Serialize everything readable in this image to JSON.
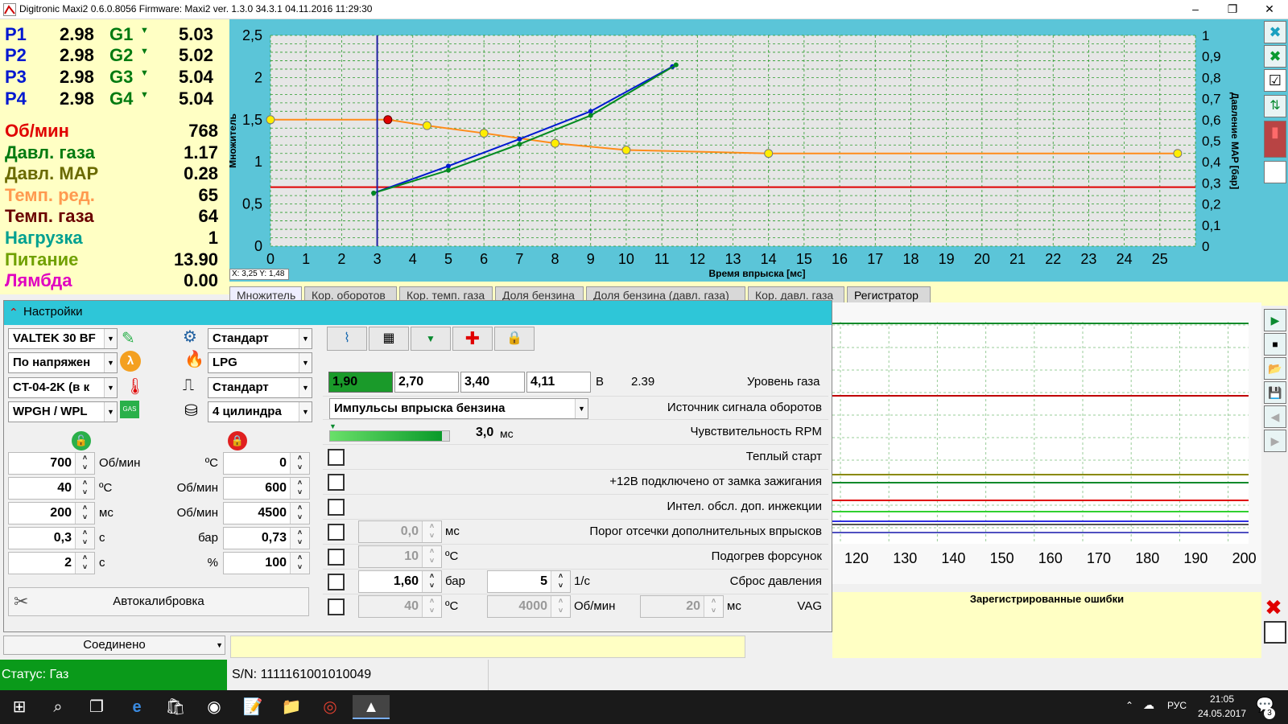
{
  "window": {
    "title": "Digitronic Maxi2 0.6.0.8056 Firmware: Maxi2  ver. 1.3.0  34.3.1   04.11.2016 11:29:30",
    "minimize": "–",
    "maximize": "❐",
    "close": "✕"
  },
  "readouts": {
    "p": [
      {
        "label": "P1",
        "value": "2.98"
      },
      {
        "label": "P2",
        "value": "2.98"
      },
      {
        "label": "P3",
        "value": "2.98"
      },
      {
        "label": "P4",
        "value": "2.98"
      }
    ],
    "g": [
      {
        "label": "G1",
        "value": "5.03"
      },
      {
        "label": "G2",
        "value": "5.02"
      },
      {
        "label": "G3",
        "value": "5.04"
      },
      {
        "label": "G4",
        "value": "5.04"
      }
    ],
    "params": [
      {
        "label": "Об/мин",
        "value": "768",
        "color": "#e00000"
      },
      {
        "label": "Давл. газа",
        "value": "1.17",
        "color": "#007a10"
      },
      {
        "label": "Давл. MAP",
        "value": "0.28",
        "color": "#6a6a00"
      },
      {
        "label": "Темп. ред.",
        "value": "65",
        "color": "#ff9a50"
      },
      {
        "label": "Темп. газа",
        "value": "64",
        "color": "#6a0000"
      },
      {
        "label": "Нагрузка",
        "value": "1",
        "color": "#00a090"
      },
      {
        "label": "Питание",
        "value": "13.90",
        "color": "#70a000"
      },
      {
        "label": "Лямбда",
        "value": "0.00",
        "color": "#e000c0"
      }
    ]
  },
  "chart_data": {
    "type": "line",
    "xlabel": "Время впрыска [мс]",
    "ylabel": "Множитель",
    "y2label": "Давление MAP [бар]",
    "xlim": [
      0,
      26
    ],
    "ylim": [
      0,
      2.5
    ],
    "y2lim": [
      0,
      1
    ],
    "xticks": [
      "0",
      "1",
      "2",
      "3",
      "4",
      "5",
      "6",
      "7",
      "8",
      "9",
      "10",
      "11",
      "12",
      "13",
      "14",
      "15",
      "16",
      "17",
      "18",
      "19",
      "20",
      "21",
      "22",
      "23",
      "24",
      "25"
    ],
    "yticks": [
      "0",
      "0,5",
      "1",
      "1,5",
      "2",
      "2,5"
    ],
    "y2ticks": [
      "0",
      "0,1",
      "0,2",
      "0,3",
      "0,4",
      "0,5",
      "0,6",
      "0,7",
      "0,8",
      "0,9",
      "1"
    ],
    "cursor_readout": "X: 3,25  Y: 1,48",
    "cursor_x": 3.0,
    "red_line_y": 0.7,
    "series": [
      {
        "points": [
          [
            0,
            1.5
          ],
          [
            3.3,
            1.5
          ],
          [
            4.4,
            1.43
          ],
          [
            6,
            1.34
          ],
          [
            8,
            1.22
          ],
          [
            10,
            1.14
          ],
          [
            14,
            1.1
          ],
          [
            25.5,
            1.1
          ]
        ],
        "color": "#ff8c1a"
      },
      {
        "points": [
          [
            2.9,
            0.63
          ],
          [
            5,
            0.95
          ],
          [
            7,
            1.27
          ],
          [
            9,
            1.6
          ],
          [
            11.3,
            2.13
          ]
        ],
        "color": "#0018d0"
      },
      {
        "points": [
          [
            2.9,
            0.63
          ],
          [
            5,
            0.9
          ],
          [
            7,
            1.21
          ],
          [
            9,
            1.55
          ],
          [
            11.4,
            2.15
          ]
        ],
        "color": "#008a20"
      }
    ],
    "yellow_points": [
      [
        0,
        1.5
      ],
      [
        4.4,
        1.43
      ],
      [
        6,
        1.34
      ],
      [
        8,
        1.22
      ],
      [
        10,
        1.14
      ],
      [
        14,
        1.1
      ],
      [
        25.5,
        1.1
      ]
    ],
    "red_point": [
      3.3,
      1.5
    ]
  },
  "tabs": [
    "Множитель",
    "Кор. оборотов",
    "Кор. темп. газа",
    "Доля бензина",
    "Доля бензина (давл. газа)",
    "Кор. давл. газа",
    "Регистратор"
  ],
  "settings": {
    "header": "Настройки",
    "left_selects": [
      "VALTEK 30 BF",
      "По напряжен",
      "CT-04-2K (в к",
      "WPGH / WPL"
    ],
    "right_selects": [
      "Стандарт",
      "LPG",
      "Стандарт",
      "4 цилиндра"
    ],
    "left_nums": [
      {
        "v": "700",
        "u": "Об/мин"
      },
      {
        "v": "40",
        "u": "ºC"
      },
      {
        "v": "200",
        "u": "мс"
      },
      {
        "v": "0,3",
        "u": "с"
      },
      {
        "v": "2",
        "u": "с"
      }
    ],
    "right_nums": [
      {
        "v": "0",
        "u": "ºC"
      },
      {
        "v": "600",
        "u": "Об/мин"
      },
      {
        "v": "4500",
        "u": "Об/мин"
      },
      {
        "v": "0,73",
        "u": "бар"
      },
      {
        "v": "100",
        "u": "%"
      }
    ],
    "autocal": "Автокалибровка",
    "gas_levels": [
      "1,90",
      "2,70",
      "3,40",
      "4,11"
    ],
    "gas_unit": "В",
    "gas_current": "2.39",
    "gas_label": "Уровень газа",
    "rpm_source": "Импульсы впрыска бензина",
    "rpm_source_label": "Источник сигнала оборотов",
    "rpm_sens_value": "3,0",
    "rpm_sens_unit": "мс",
    "rpm_sens_label": "Чувствительность RPM",
    "warm_start": "Теплый старт",
    "plus12": "+12В подключено от замка зажигания",
    "intel": "Интел. обсл. доп. инжекции",
    "cutoff_value": "0,0",
    "cutoff_unit": "мс",
    "cutoff_label": "Порог отсечки дополнительных впрысков",
    "heat_value": "10",
    "heat_unit": "ºC",
    "heat_label": "Подогрев форсунок",
    "reset_value": "1,60",
    "reset_unit": "бар",
    "reset_value2": "5",
    "reset_unit2": "1/с",
    "reset_label": "Сброс давления",
    "vag_v1": "40",
    "vag_u1": "ºC",
    "vag_v2": "4000",
    "vag_u2": "Об/мин",
    "vag_v3": "20",
    "vag_u3": "мс",
    "vag_label": "VAG"
  },
  "recorder": {
    "xticks": [
      "120",
      "130",
      "140",
      "150",
      "160",
      "170",
      "180",
      "190",
      "200"
    ]
  },
  "errors": {
    "title": "Зарегистрированные ошибки"
  },
  "status": {
    "connection": "Соединено",
    "state": "Статус: Газ",
    "serial": "S/N: 1111161001010049"
  },
  "taskbar": {
    "lang": "РУС",
    "time": "21:05",
    "date": "24.05.2017",
    "notif": "3"
  }
}
